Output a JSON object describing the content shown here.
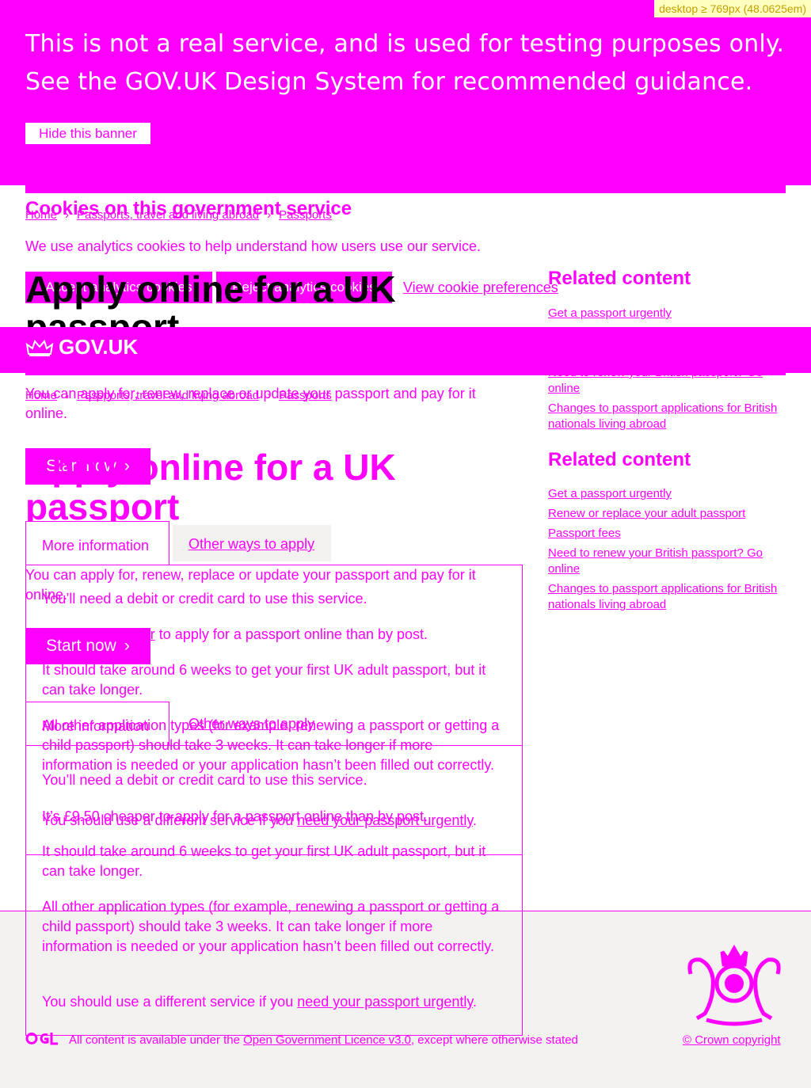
{
  "debug": {
    "media_query": "desktop ≥ 769px (48.0625em)"
  },
  "phase_banner": {
    "line1": "This is not a real service, and is used for testing purposes only.",
    "line2_pre": "See the ",
    "line2_link": "GOV.UK Design System",
    "line2_post": " for recommended guidance.",
    "hide_button": "Hide this banner"
  },
  "cookie_banner": {
    "heading": "Cookies on this government service",
    "text": "We use analytics cookies to help understand how users use our service.",
    "accept": "Accept analytics cookies",
    "reject": "Reject analytics cookies",
    "view": "View cookie preferences"
  },
  "header": {
    "logo": "GOV.UK",
    "crown_icon": "crown-icon"
  },
  "breadcrumbs": [
    "Home",
    "Passports, travel and living abroad",
    "Passports"
  ],
  "page": {
    "title": "Apply online for a UK passport",
    "title_line1": "Apply online for a UK",
    "title_line2": "passport",
    "intro": "You can apply for, renew, replace or update your passport and pay for it online.",
    "start_button": "Start now"
  },
  "tabs": {
    "active": "More information",
    "inactive": "Other ways to apply"
  },
  "panel": {
    "p1": "You’ll need a debit or credit card to use this service.",
    "p2_pre": "It’s £9.50 ",
    "p2_link": "cheaper",
    "p2_post": " to apply for a passport online than by post.",
    "p3": "It should take around 6 weeks to get your first UK adult passport, but it can take longer.",
    "p4": "All other application types (for example, renewing a passport or getting a child passport) should take 3 weeks. It can take longer if more information is needed or your application hasn’t been filled out correctly.",
    "p5_pre": "You should use a different service if you ",
    "p5_link": "need your passport urgently",
    "p5_post": "."
  },
  "related": {
    "heading": "Related content",
    "links": [
      "Get a passport urgently",
      "Renew or replace your adult passport",
      "Passport fees",
      "Need to renew your British passport? Go online",
      "Changes to passport applications for British nationals living abroad"
    ]
  },
  "footer": {
    "ogl_icon": "ogl-icon",
    "licence_pre": "All content is available under the ",
    "licence_link": "Open Government Licence v3.0",
    "licence_post": ", except where otherwise stated",
    "copyright": "© Crown copyright",
    "crest_icon": "royal-coat-of-arms-icon"
  }
}
